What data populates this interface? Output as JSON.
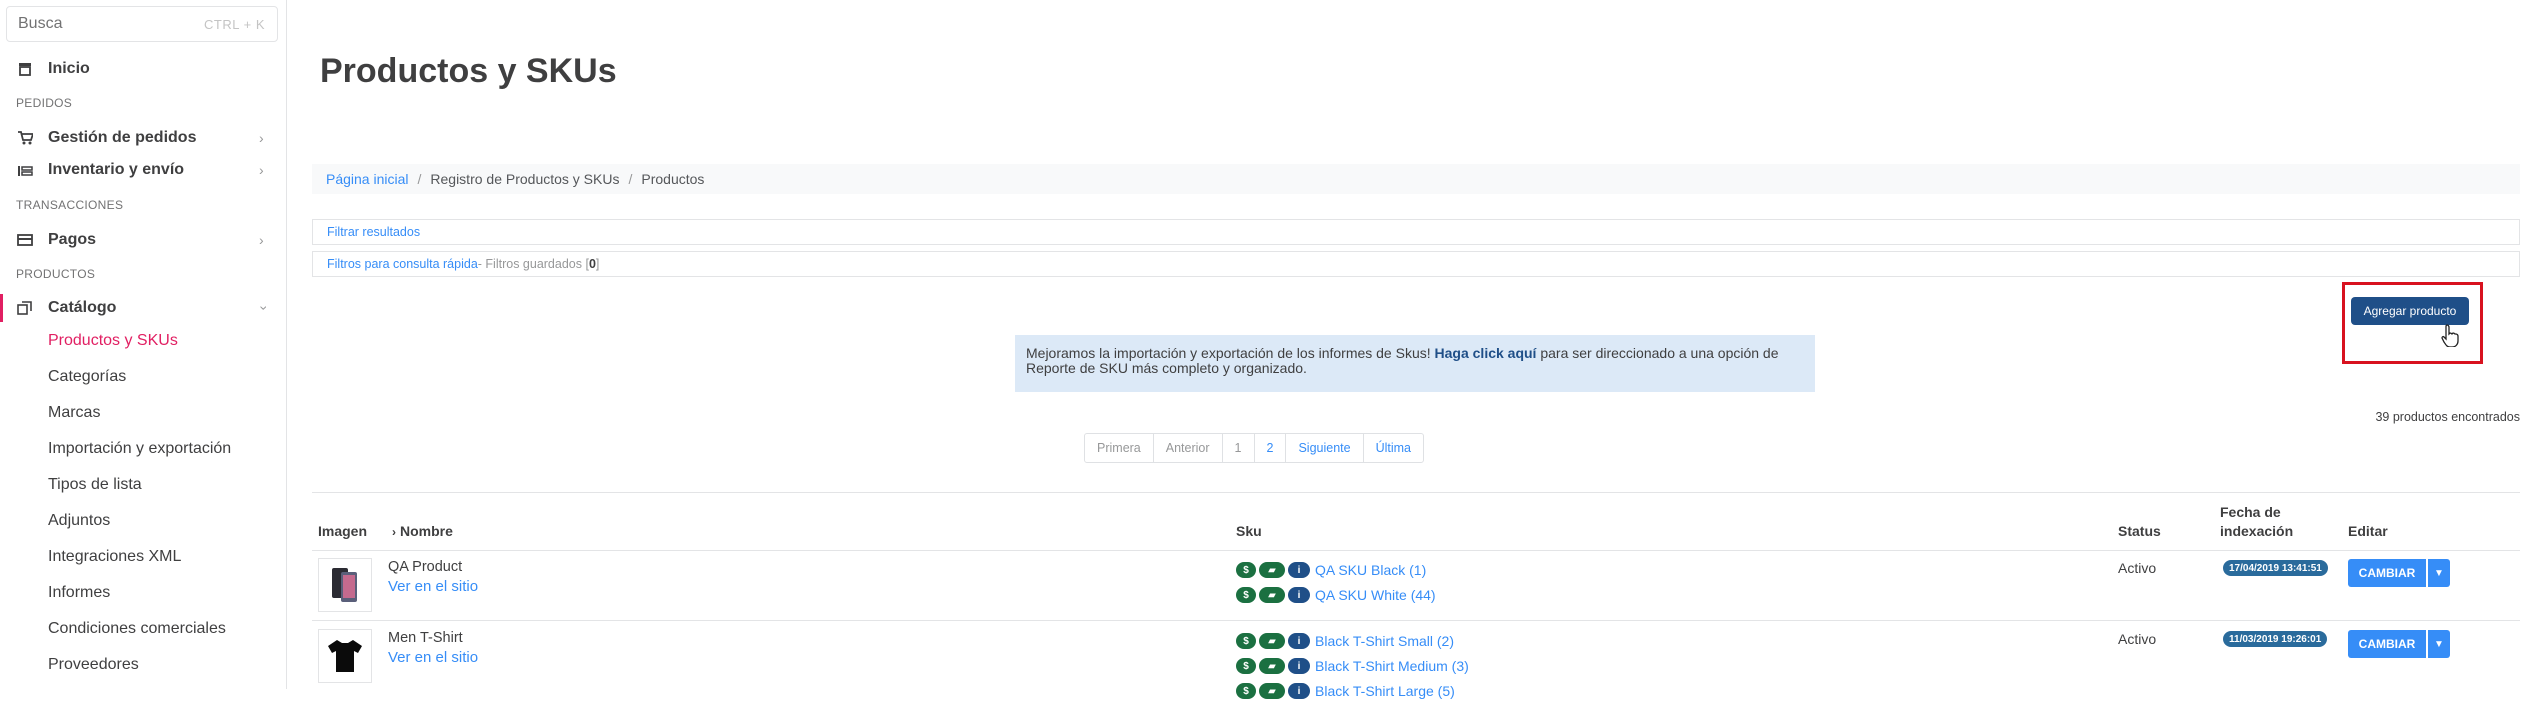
{
  "sidebar": {
    "search": {
      "placeholder": "Busca",
      "shortcut": "CTRL + K"
    },
    "items": [
      {
        "icon": "store-icon",
        "label": "Inicio"
      },
      {
        "section": "PEDIDOS"
      },
      {
        "icon": "cart-icon",
        "label": "Gestión de pedidos"
      },
      {
        "icon": "inventory-icon",
        "label": "Inventario y envío"
      },
      {
        "section": "TRANSACCIONES"
      },
      {
        "icon": "card-icon",
        "label": "Pagos"
      },
      {
        "section": "PRODUCTOS"
      },
      {
        "icon": "catalog-icon",
        "label": "Catálogo"
      }
    ],
    "sections": {
      "pedidos": "PEDIDOS",
      "transacciones": "TRANSACCIONES",
      "productos": "PRODUCTOS"
    },
    "nav": {
      "inicio": "Inicio",
      "gestion": "Gestión de pedidos",
      "inventario": "Inventario y envío",
      "pagos": "Pagos",
      "catalogo": "Catálogo"
    },
    "catalog_items": [
      "Productos y SKUs",
      "Categorías",
      "Marcas",
      "Importación y exportación",
      "Tipos de lista",
      "Adjuntos",
      "Integraciones XML",
      "Informes",
      "Condiciones comerciales",
      "Proveedores"
    ]
  },
  "page": {
    "title": "Productos y SKUs",
    "breadcrumb": [
      "Página inicial",
      "Registro de Productos y SKUs",
      "Productos"
    ],
    "filter_results": "Filtrar resultados",
    "quick_filters": "Filtros para consulta rápida",
    "saved_filters_prefix": " - Filtros guardados [",
    "saved_filters_count": "0",
    "saved_filters_suffix": "]",
    "add_button": "Agregar producto",
    "info_text_1": "Mejoramos la importación y exportación de los informes de Skus! ",
    "info_link": "Haga click aquí",
    "info_text_2": " para ser direccionado a una opción de Reporte de SKU más completo y organizado.",
    "found": "39 productos encontrados",
    "pagination": [
      "Primera",
      "Anterior",
      "1",
      "2",
      "Siguiente",
      "Última"
    ]
  },
  "table": {
    "headers": {
      "image": "Imagen",
      "name": "Nombre",
      "sku": "Sku",
      "status": "Status",
      "date": "Fecha de indexación",
      "edit": "Editar"
    },
    "rows": [
      {
        "name": "QA Product",
        "link": "Ver en el sitio",
        "skus": [
          "QA SKU Black (1)",
          "QA SKU White (44)"
        ],
        "status": "Activo",
        "date": "17/04/2019 13:41:51",
        "edit": "CAMBIAR"
      },
      {
        "name": "Men T-Shirt",
        "link": "Ver en el sitio",
        "skus": [
          "Black T-Shirt Small (2)",
          "Black T-Shirt Medium (3)",
          "Black T-Shirt Large (5)"
        ],
        "status": "Activo",
        "date": "11/03/2019 19:26:01",
        "edit": "CAMBIAR"
      }
    ]
  },
  "colors": {
    "accent": "#e11f62",
    "link": "#368df7",
    "primary": "#1f4f88",
    "highlight": "#d8121f"
  }
}
